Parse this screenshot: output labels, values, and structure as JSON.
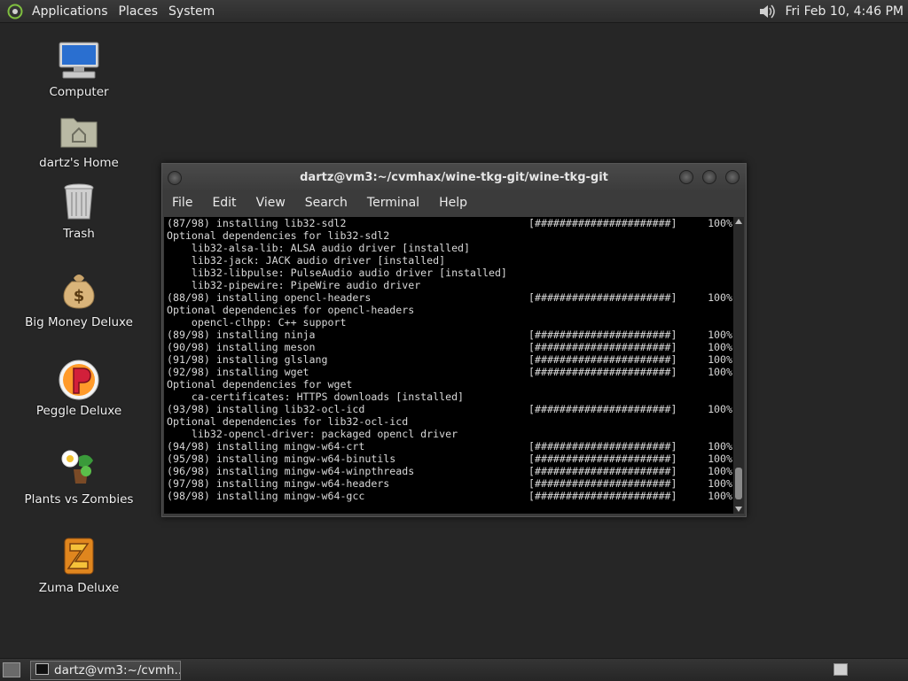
{
  "top_panel": {
    "menus": [
      "Applications",
      "Places",
      "System"
    ],
    "clock": "Fri Feb 10,  4:46 PM"
  },
  "desktop_icons": [
    {
      "label": "Computer",
      "icon": "computer-icon"
    },
    {
      "label": "dartz's Home",
      "icon": "home-folder-icon"
    },
    {
      "label": "Trash",
      "icon": "trash-icon"
    },
    {
      "label": "Big Money Deluxe",
      "icon": "money-bag-icon"
    },
    {
      "label": "Peggle Deluxe",
      "icon": "peggle-icon"
    },
    {
      "label": "Plants vs Zombies",
      "icon": "plants-vs-zombies-icon"
    },
    {
      "label": "Zuma Deluxe",
      "icon": "zuma-icon"
    }
  ],
  "terminal": {
    "title": "dartz@vm3:~/cvmhax/wine-tkg-git/wine-tkg-git",
    "menu": [
      "File",
      "Edit",
      "View",
      "Search",
      "Terminal",
      "Help"
    ],
    "lines": [
      {
        "text": "(87/98) installing lib32-sdl2",
        "bar": "[######################]",
        "pct": "100%"
      },
      {
        "text": "Optional dependencies for lib32-sdl2"
      },
      {
        "text": "    lib32-alsa-lib: ALSA audio driver [installed]"
      },
      {
        "text": "    lib32-jack: JACK audio driver [installed]"
      },
      {
        "text": "    lib32-libpulse: PulseAudio audio driver [installed]"
      },
      {
        "text": "    lib32-pipewire: PipeWire audio driver"
      },
      {
        "text": "(88/98) installing opencl-headers",
        "bar": "[######################]",
        "pct": "100%"
      },
      {
        "text": "Optional dependencies for opencl-headers"
      },
      {
        "text": "    opencl-clhpp: C++ support"
      },
      {
        "text": "(89/98) installing ninja",
        "bar": "[######################]",
        "pct": "100%"
      },
      {
        "text": "(90/98) installing meson",
        "bar": "[######################]",
        "pct": "100%"
      },
      {
        "text": "(91/98) installing glslang",
        "bar": "[######################]",
        "pct": "100%"
      },
      {
        "text": "(92/98) installing wget",
        "bar": "[######################]",
        "pct": "100%"
      },
      {
        "text": "Optional dependencies for wget"
      },
      {
        "text": "    ca-certificates: HTTPS downloads [installed]"
      },
      {
        "text": "(93/98) installing lib32-ocl-icd",
        "bar": "[######################]",
        "pct": "100%"
      },
      {
        "text": "Optional dependencies for lib32-ocl-icd"
      },
      {
        "text": "    lib32-opencl-driver: packaged opencl driver"
      },
      {
        "text": "(94/98) installing mingw-w64-crt",
        "bar": "[######################]",
        "pct": "100%"
      },
      {
        "text": "(95/98) installing mingw-w64-binutils",
        "bar": "[######################]",
        "pct": "100%"
      },
      {
        "text": "(96/98) installing mingw-w64-winpthreads",
        "bar": "[######################]",
        "pct": "100%"
      },
      {
        "text": "(97/98) installing mingw-w64-headers",
        "bar": "[######################]",
        "pct": "100%"
      },
      {
        "text": "(98/98) installing mingw-w64-gcc",
        "bar": "[######################]",
        "pct": "100%"
      }
    ]
  },
  "taskbar": {
    "task_label": "dartz@vm3:~/cvmh..."
  },
  "colors": {
    "desktop_bg": "#262626",
    "panel_bg": "#2c2c2c",
    "terminal_bg": "#000000",
    "terminal_text": "#d8d8d8"
  }
}
